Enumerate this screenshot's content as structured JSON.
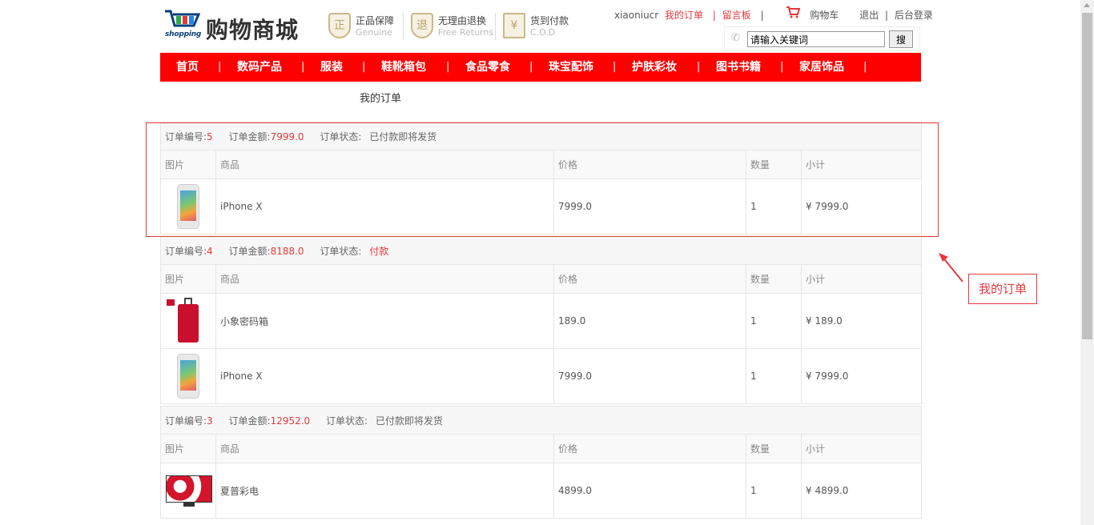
{
  "brand": {
    "cart_word": "shopping",
    "title": "购物商城"
  },
  "badges": [
    {
      "icon": "正",
      "title": "正品保障",
      "sub": "Genuine"
    },
    {
      "icon": "退",
      "title": "无理由退换",
      "sub": "Free Returns"
    },
    {
      "icon": "¥",
      "title": "货到付款",
      "sub": "C.O.D"
    }
  ],
  "topnav": {
    "username": "xiaoniucr",
    "my_orders": "我的订单",
    "sep": "|",
    "message_board": "留言板",
    "cart": "购物车",
    "logout": "退出",
    "admin_login": "后台登录"
  },
  "search": {
    "value": "请输入关键词",
    "button": "搜"
  },
  "menu": [
    "首页",
    "数码产品",
    "服装",
    "鞋靴箱包",
    "食品零食",
    "珠宝配饰",
    "护肤彩妆",
    "图书书籍",
    "家居饰品"
  ],
  "menu_sep": "|",
  "page_title": "我的订单",
  "labels": {
    "order_no": "订单编号:",
    "amount": "订单金额:",
    "status": "订单状态:",
    "col_image": "图片",
    "col_product": "商品",
    "col_price": "价格",
    "col_qty": "数量",
    "col_subtotal": "小计"
  },
  "orders": [
    {
      "id": "5",
      "amount": "7999.0",
      "status": "已付款即将发货",
      "items": [
        {
          "name": "iPhone X",
          "price": "7999.0",
          "qty": "1",
          "subtotal": "¥ 7999.0",
          "img": "phone"
        }
      ]
    },
    {
      "id": "4",
      "amount": "8188.0",
      "status": "付款",
      "items": [
        {
          "name": "小象密码箱",
          "price": "189.0",
          "qty": "1",
          "subtotal": "¥ 189.0",
          "img": "luggage"
        },
        {
          "name": "iPhone X",
          "price": "7999.0",
          "qty": "1",
          "subtotal": "¥ 7999.0",
          "img": "phone"
        }
      ]
    },
    {
      "id": "3",
      "amount": "12952.0",
      "status": "已付款即将发货",
      "items": [
        {
          "name": "夏普彩电",
          "price": "4899.0",
          "qty": "1",
          "subtotal": "¥ 4899.0",
          "img": "tv"
        }
      ]
    }
  ],
  "annotation": {
    "label": "我的订单",
    "color": "#e4393c"
  }
}
